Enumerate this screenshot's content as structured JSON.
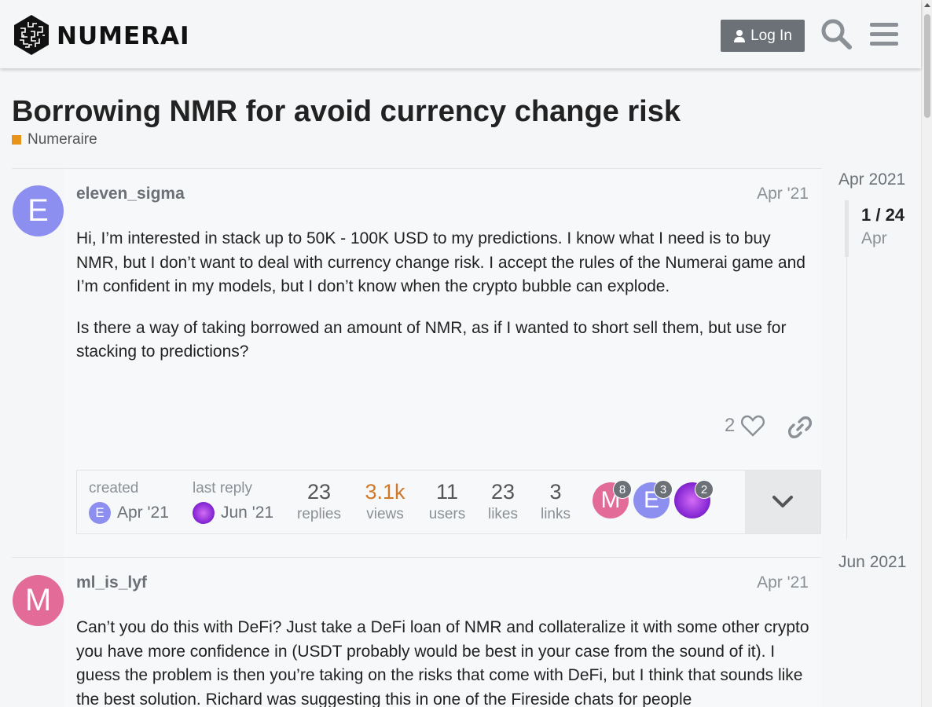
{
  "header": {
    "brand": "NUMERAI",
    "login_label": "Log In"
  },
  "topic": {
    "title": "Borrowing NMR for avoid currency change risk",
    "category": "Numeraire",
    "category_color": "#e8941a"
  },
  "posts": [
    {
      "username": "eleven_sigma",
      "avatar_letter": "E",
      "avatar_color": "#8c8ff0",
      "date": "Apr '21",
      "paragraphs": [
        "Hi, I’m interested in stack up to 50K - 100K USD to my predictions. I know what I need is to buy NMR, but I don’t want to deal with currency change risk. I accept the rules of the Numerai game and I’m confident in my models, but I don’t know when the crypto bubble can explode.",
        "Is there a way of taking borrowed an amount of NMR, as if I wanted to short sell them, but use for stacking to predictions?"
      ],
      "like_count": "2"
    },
    {
      "username": "ml_is_lyf",
      "avatar_letter": "M",
      "avatar_color": "#e36b97",
      "date": "Apr '21",
      "paragraphs": [
        "Can’t you do this with DeFi? Just take a DeFi loan of NMR and collateralize it with some other crypto you have more confidence in (USDT probably would be best in your case from the sound of it). I guess the problem is then you’re taking on the risks that come with DeFi, but I think that sounds like the best solution. Richard was suggesting this in one of the Fireside chats for people"
      ]
    }
  ],
  "topic_map": {
    "created_label": "created",
    "created_date": "Apr '21",
    "last_reply_label": "last reply",
    "last_reply_date": "Jun '21",
    "stats": [
      {
        "value": "23",
        "label": "replies"
      },
      {
        "value": "3.1k",
        "label": "views"
      },
      {
        "value": "11",
        "label": "users"
      },
      {
        "value": "23",
        "label": "likes"
      },
      {
        "value": "3",
        "label": "links"
      }
    ],
    "views_color": "#d0782a",
    "participants": [
      {
        "letter": "M",
        "count": "8",
        "color": "#e36b97"
      },
      {
        "letter": "E",
        "count": "3",
        "color": "#8c8ff0"
      },
      {
        "letter": "",
        "count": "2",
        "color": "#9b30d9"
      }
    ]
  },
  "timeline": {
    "start": "Apr 2021",
    "position": "1 / 24",
    "current_month": "Apr",
    "end": "Jun 2021"
  }
}
